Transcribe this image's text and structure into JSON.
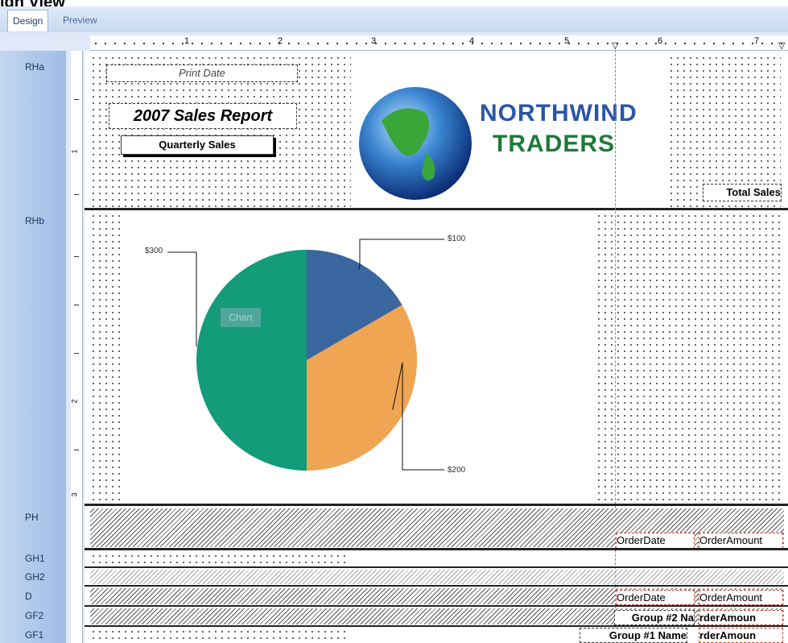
{
  "window": {
    "title": "ign View"
  },
  "tabs": [
    {
      "label": "Design",
      "active": true
    },
    {
      "label": "Preview",
      "active": false
    }
  ],
  "ruler": {
    "horizontal": [
      "1",
      "2",
      "3",
      "4",
      "5",
      "6",
      "7"
    ],
    "vertical": [
      "1",
      "2",
      "3"
    ]
  },
  "bands": {
    "rha": {
      "label": "RHa"
    },
    "rhb": {
      "label": "RHb"
    },
    "ph": {
      "label": "PH"
    },
    "gh1": {
      "label": "GH1"
    },
    "gh2": {
      "label": "GH2"
    },
    "d": {
      "label": "D"
    },
    "gf2": {
      "label": "GF2"
    },
    "gf1": {
      "label": "GF1"
    }
  },
  "report": {
    "print_date": "Print Date",
    "title": "2007 Sales Report",
    "subtitle": "Quarterly Sales",
    "total_sales": "Total Sales",
    "logo": {
      "line1": "NORTHWIND",
      "line2": "TRADERS"
    }
  },
  "chart_box": {
    "label": "Chart"
  },
  "chart_data": {
    "type": "pie",
    "slices": [
      {
        "label": "$100",
        "value": 100,
        "color": "#3b67a0"
      },
      {
        "label": "$200",
        "value": 200,
        "color": "#f0a552"
      },
      {
        "label": "$300",
        "value": 300,
        "color": "#139b7a"
      }
    ]
  },
  "fields": {
    "ph_order_date": "OrderDate",
    "ph_order_amount": "OrderAmount",
    "d_order_date": "OrderDate",
    "d_order_amount": "OrderAmount",
    "gf2_group_name": "Group #2 Na",
    "gf2_amount": "rderAmoun",
    "gf1_group_name": "Group #1 Name",
    "gf1_amount": "rderAmoun"
  },
  "colors": {
    "accent": "#1f3d70",
    "logo_blue": "#2a56a8",
    "logo_green": "#1f7a3a"
  }
}
